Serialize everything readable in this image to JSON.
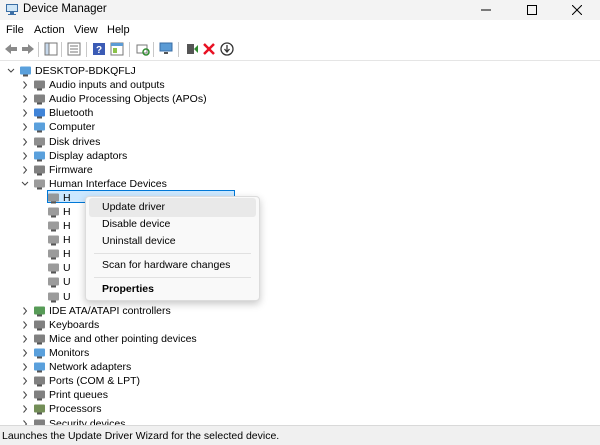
{
  "window": {
    "title": "Device Manager"
  },
  "menu": [
    "File",
    "Action",
    "View",
    "Help"
  ],
  "toolbar": {
    "icons": [
      "back-arrow-icon",
      "forward-arrow-icon",
      "show-hide-tree-icon",
      "properties-icon",
      "help-icon",
      "action-pane-icon",
      "scan-hardware-icon",
      "monitor-icon",
      "update-driver-icon",
      "uninstall-x-icon",
      "disable-device-icon"
    ]
  },
  "tree": {
    "root": "DESKTOP-BDKQFLJ",
    "categories": [
      {
        "label": "Audio inputs and outputs",
        "icon": "audio-icon",
        "expanded": false
      },
      {
        "label": "Audio Processing Objects (APOs)",
        "icon": "audio-icon",
        "expanded": false
      },
      {
        "label": "Bluetooth",
        "icon": "bluetooth-icon",
        "expanded": false
      },
      {
        "label": "Computer",
        "icon": "computer-icon",
        "expanded": false
      },
      {
        "label": "Disk drives",
        "icon": "disk-icon",
        "expanded": false
      },
      {
        "label": "Display adaptors",
        "icon": "display-icon",
        "expanded": false
      },
      {
        "label": "Firmware",
        "icon": "firmware-icon",
        "expanded": false
      },
      {
        "label": "Human Interface Devices",
        "icon": "hid-icon",
        "expanded": true
      }
    ],
    "hid_children": [
      "H",
      "H",
      "H",
      "H",
      "H",
      "U",
      "U",
      "U"
    ],
    "categories_after": [
      {
        "label": "IDE ATA/ATAPI controllers",
        "icon": "ide-icon"
      },
      {
        "label": "Keyboards",
        "icon": "keyboard-icon"
      },
      {
        "label": "Mice and other pointing devices",
        "icon": "mouse-icon"
      },
      {
        "label": "Monitors",
        "icon": "monitor-icon"
      },
      {
        "label": "Network adapters",
        "icon": "network-icon"
      },
      {
        "label": "Ports (COM & LPT)",
        "icon": "port-icon"
      },
      {
        "label": "Print queues",
        "icon": "printer-icon"
      },
      {
        "label": "Processors",
        "icon": "processor-icon"
      },
      {
        "label": "Security devices",
        "icon": "security-icon"
      }
    ]
  },
  "context_menu": {
    "update_driver": "Update driver",
    "disable_device": "Disable device",
    "uninstall_device": "Uninstall device",
    "scan_hardware": "Scan for hardware changes",
    "properties": "Properties"
  },
  "status": "Launches the Update Driver Wizard for the selected device.",
  "colors": {
    "accent": "#0078d7",
    "selection": "#cce8ff",
    "uninstall_red": "#e81123",
    "update_green": "#2e8b2e"
  }
}
